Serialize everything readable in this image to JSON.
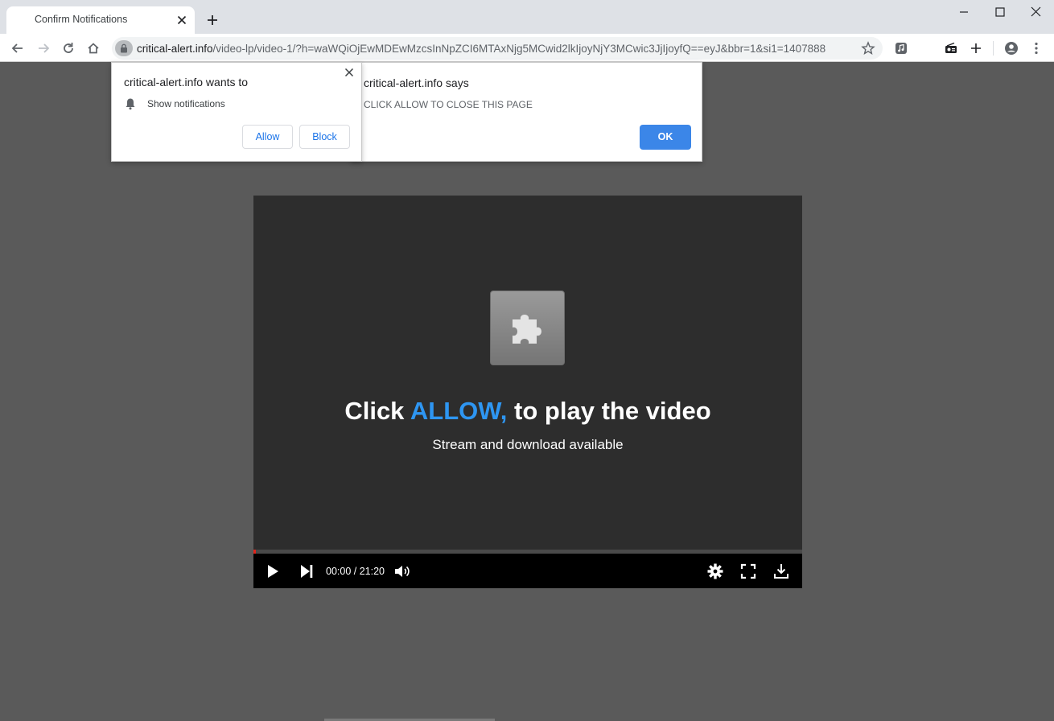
{
  "browser": {
    "tab_title": "Confirm Notifications",
    "url_host": "critical-alert.info",
    "url_path": "/video-lp/video-1/?h=waWQiOjEwMDEwMzcsInNpZCI6MTAxNjg5MCwid2lkIjoyNjY3MCwic3JjIjoyfQ==eyJ&bbr=1&si1=1407888"
  },
  "notification_prompt": {
    "title": "critical-alert.info wants to",
    "permission": "Show notifications",
    "allow_label": "Allow",
    "block_label": "Block"
  },
  "alert_dialog": {
    "title": "critical-alert.info says",
    "message": "CLICK ALLOW TO CLOSE THIS PAGE",
    "ok_label": "OK"
  },
  "player": {
    "headline_prefix": "Click ",
    "headline_accent": "ALLOW,",
    "headline_suffix": " to play the video",
    "subline": "Stream and download available",
    "time": "00:00 / 21:20",
    "progress": 0.005
  },
  "colors": {
    "accent": "#2e96f2",
    "ok_button": "#3b86e8",
    "link_blue": "#1a73e8",
    "page_bg": "#5a5a5a",
    "player_bg": "#2d2d2d"
  }
}
